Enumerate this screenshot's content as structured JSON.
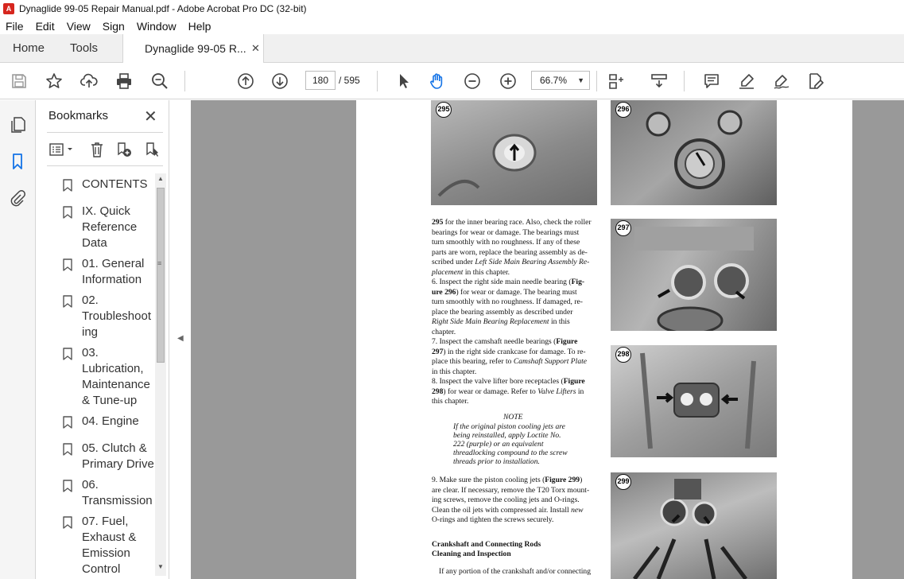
{
  "window": {
    "title": "Dynaglide 99-05 Repair Manual.pdf - Adobe Acrobat Pro DC (32-bit)",
    "app_icon": "acrobat-icon"
  },
  "menu": [
    "File",
    "Edit",
    "View",
    "Sign",
    "Window",
    "Help"
  ],
  "tabs": {
    "home": "Home",
    "tools": "Tools",
    "document": "Dynaglide 99-05 R...",
    "close_glyph": "✕"
  },
  "toolbar": {
    "left_icons": [
      "save-icon",
      "star-icon",
      "upload-icon",
      "print-icon",
      "zoom-search-icon"
    ],
    "nav_icons": [
      "page-up-icon",
      "page-down-icon"
    ],
    "current_page": "180",
    "page_total": "/ 595",
    "tools": [
      "select-arrow-icon",
      "hand-icon",
      "zoom-out-icon",
      "zoom-in-icon"
    ],
    "zoom": "66.7%",
    "right_icons": [
      "page-layout-icon",
      "scroll-mode-icon",
      "comment-icon",
      "highlight-icon",
      "sign-icon",
      "edit-pdf-icon"
    ],
    "accent_color": "#1473e6"
  },
  "left_rail": {
    "icons": [
      "pages-icon",
      "bookmark-icon",
      "attachment-icon"
    ]
  },
  "bookmarks": {
    "title": "Bookmarks",
    "close_glyph": "✕",
    "tool_icons": [
      "options-icon",
      "delete-icon",
      "new-bookmark-icon",
      "new-bookmark-from-structure-icon"
    ],
    "items": [
      {
        "lines": [
          "CONTENTS"
        ]
      },
      {
        "lines": [
          "IX. Quick",
          "Reference",
          "Data"
        ]
      },
      {
        "lines": [
          "01. General",
          "Information"
        ]
      },
      {
        "lines": [
          "02.",
          "Troubleshoot",
          "ing"
        ]
      },
      {
        "lines": [
          "03.",
          "Lubrication,",
          "Maintenance",
          "& Tune-up"
        ]
      },
      {
        "lines": [
          "04. Engine"
        ]
      },
      {
        "lines": [
          "05. Clutch &",
          "Primary Drive"
        ]
      },
      {
        "lines": [
          "06.",
          "Transmission"
        ]
      },
      {
        "lines": [
          "07. Fuel,",
          "Exhaust &",
          "Emission",
          "Control"
        ]
      }
    ]
  },
  "document": {
    "figures": [
      "295",
      "296",
      "297",
      "298",
      "299"
    ],
    "body_lines_1": [
      [
        "",
        "295",
        " for the inner bearing race. Also, check the roller"
      ],
      [
        "bearings for wear or damage. The bearings must",
        "",
        ""
      ],
      [
        "turn smoothly with no roughness. If any of these",
        "",
        ""
      ],
      [
        "parts are worn, replace the bearing assembly as de-",
        "",
        ""
      ],
      [
        "scribed under ",
        "",
        ""
      ],
      [
        "",
        "",
        ""
      ]
    ],
    "para_a": {
      "l1": "295",
      "l1_rest": " for the inner bearing race. Also, check the roller",
      "l2": "bearings for wear or damage. The bearings must",
      "l3": "turn smoothly with no roughness. If any of these",
      "l4": "parts are worn, replace the bearing assembly as de-",
      "l5_pre": "scribed under ",
      "l5_it": "Left Side Main Bearing Assembly Re-",
      "l6_it": "placement",
      "l6_rest": " in this chapter."
    },
    "para_6": {
      "l1_pre": "6.  Inspect the right side main needle bearing (",
      "l1_b": "Fig-",
      "l2_b": "ure 296",
      "l2_rest": ") for wear or damage. The bearing must",
      "l3": "turn smoothly with no roughness. If damaged, re-",
      "l4": "place the bearing assembly as described under",
      "l5_it": "Right Side Main Bearing Replacement",
      "l5_rest": " in this",
      "l6": "chapter."
    },
    "para_7": {
      "l1_pre": "7.  Inspect the camshaft needle bearings (",
      "l1_b": "Figure",
      "l2_b": "297",
      "l2_rest": ") in the right side crankcase for damage. To re-",
      "l3_pre": "place this bearing, refer to ",
      "l3_it": "Camshaft Support Plate",
      "l4": "in this chapter."
    },
    "para_8": {
      "l1_pre": "8.  Inspect the valve lifter bore receptacles (",
      "l1_b": "Figure",
      "l2_b": "298",
      "l2_pre": ") for wear or damage. Refer to ",
      "l2_it": "Valve Lifters",
      "l2_rest": " in",
      "l3": "this chapter."
    },
    "note": {
      "title": "NOTE",
      "lines": [
        "If the original piston cooling jets are",
        "being reinstalled, apply Loctite No.",
        "222 (purple) or an equivalent",
        "threadlocking compound to the screw",
        "threads prior to installation."
      ]
    },
    "para_9": {
      "l1_pre": "9.  Make sure the piston cooling jets (",
      "l1_b": "Figure 299",
      "l1_rest": ")",
      "l2": "are clear. If necessary, remove the T20 Torx mount-",
      "l3": "ing screws, remove the cooling jets and O-rings.",
      "l4_pre": "Clean the oil jets with compressed air. Install ",
      "l4_it": "new",
      "l5": "O-rings and tighten the screws securely."
    },
    "heading": {
      "l1": "Crankshaft and Connecting Rods",
      "l2": "Cleaning and Inspection"
    },
    "last_line": "If any portion of the crankshaft and/or connecting"
  }
}
